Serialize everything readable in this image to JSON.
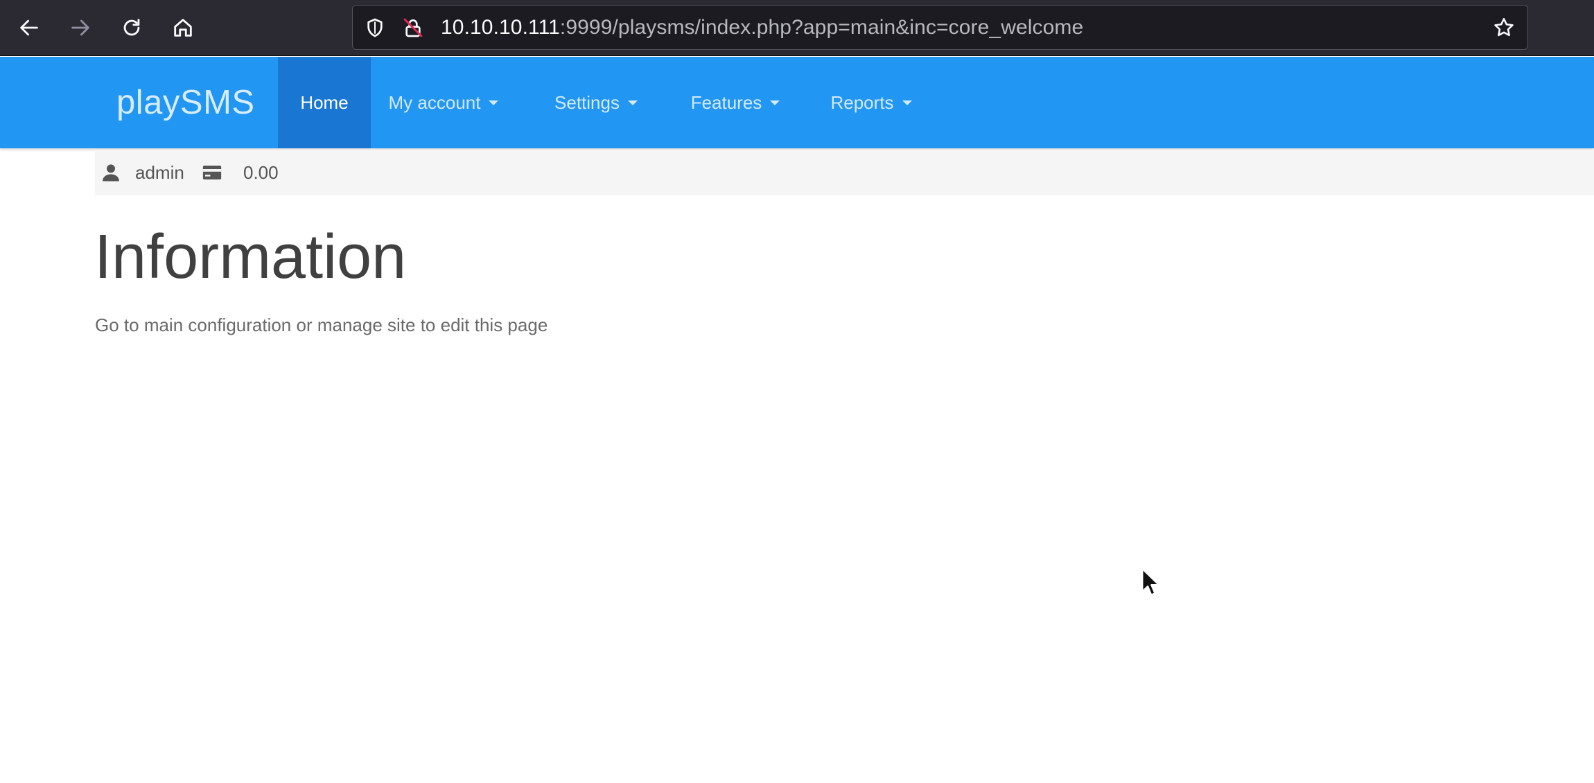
{
  "browser": {
    "url_host": "10.10.10.111",
    "url_rest": ":9999/playsms/index.php?app=main&inc=core_welcome",
    "icons": {
      "back": "back-arrow-icon",
      "forward": "forward-arrow-icon",
      "reload": "reload-icon",
      "home": "home-icon",
      "shield": "shield-icon",
      "insecure": "insecure-lock-icon",
      "bookmark": "star-icon"
    }
  },
  "navbar": {
    "brand": "playSMS",
    "items": [
      {
        "label": "Home",
        "active": true,
        "dropdown": false
      },
      {
        "label": "My account",
        "active": false,
        "dropdown": true
      },
      {
        "label": "Settings",
        "active": false,
        "dropdown": true
      },
      {
        "label": "Features",
        "active": false,
        "dropdown": true
      },
      {
        "label": "Reports",
        "active": false,
        "dropdown": true
      }
    ],
    "colors": {
      "bar": "#2196f3",
      "active": "#1976d2"
    }
  },
  "userbar": {
    "username": "admin",
    "credit": "0.00",
    "icons": {
      "user": "user-icon",
      "credit": "credit-card-icon"
    }
  },
  "content": {
    "title": "Information",
    "description": "Go to main configuration or manage site to edit this page"
  }
}
